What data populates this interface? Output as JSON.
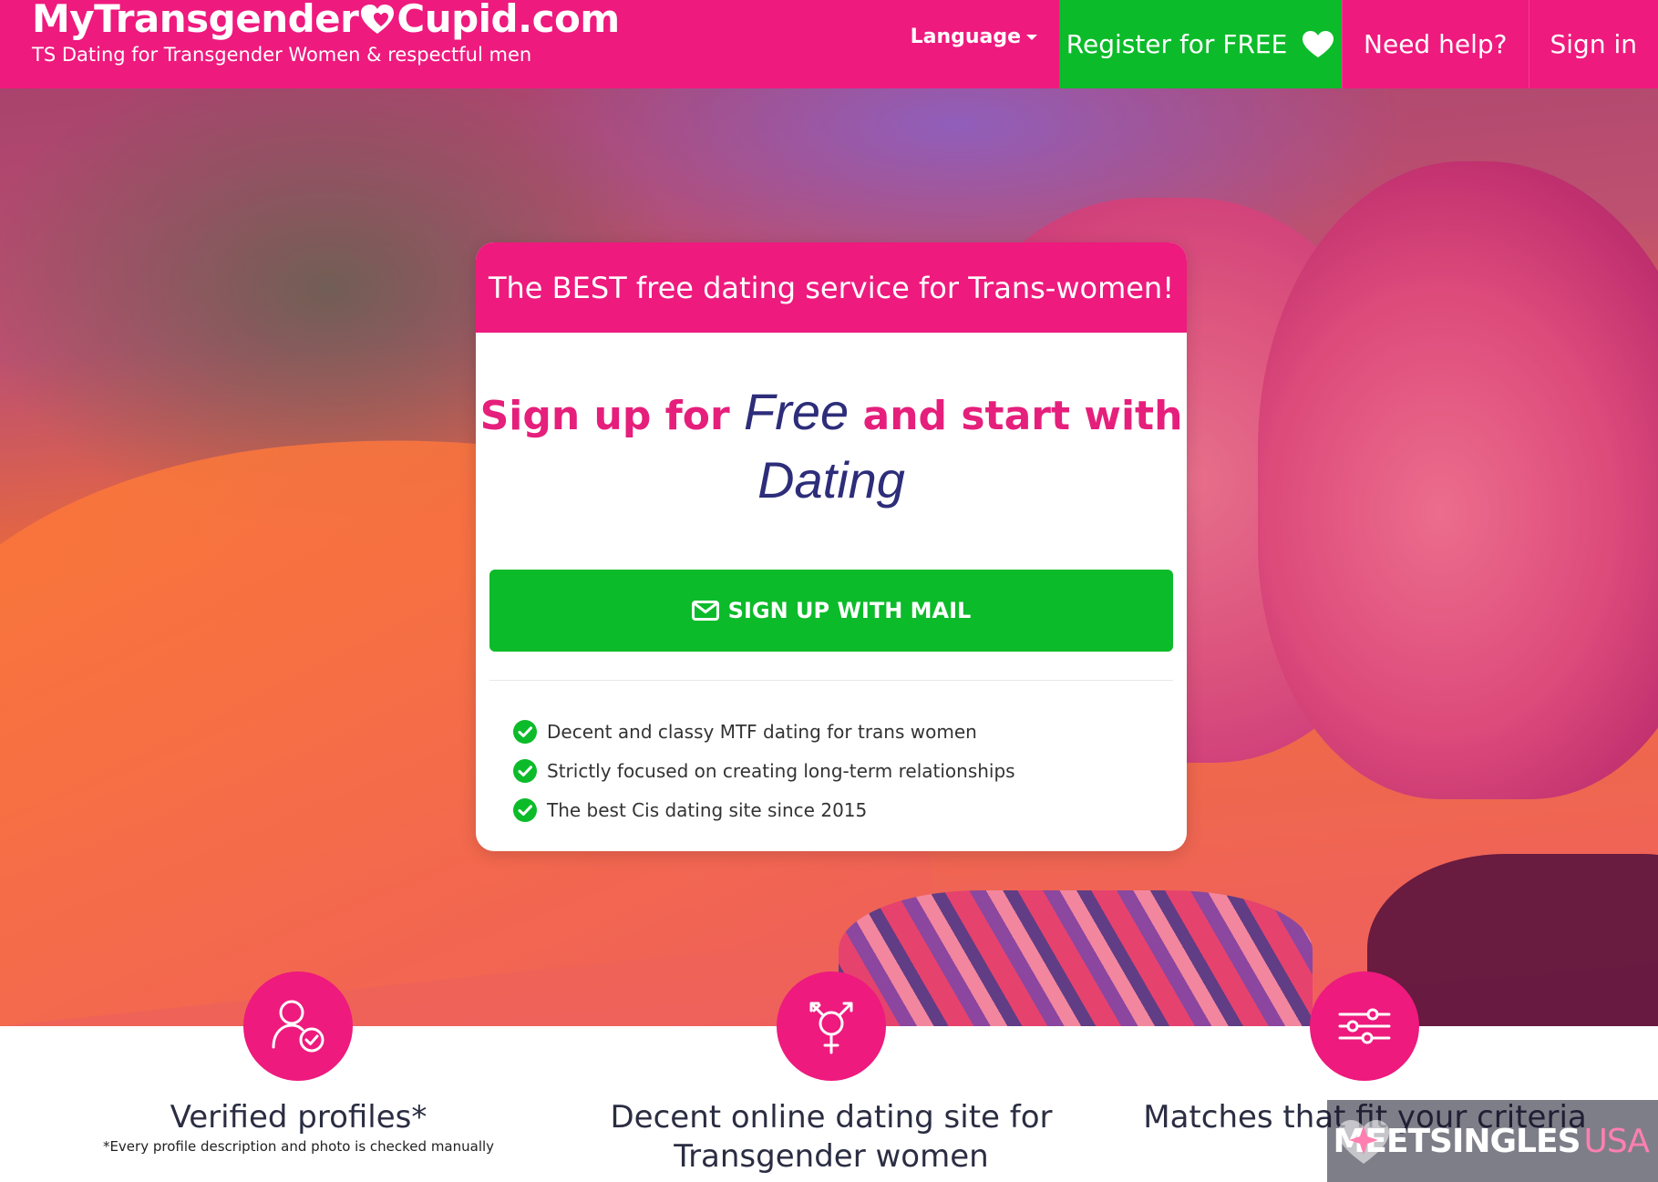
{
  "header": {
    "logo_part1": "MyTransgender",
    "logo_part2": "Cupid.com",
    "tagline": "TS Dating for Transgender Women & respectful men",
    "nav": {
      "language": "Language",
      "register": "Register for FREE",
      "help": "Need help?",
      "signin": "Sign in"
    }
  },
  "card": {
    "header": "The BEST free dating service for Trans-women!",
    "title_part1": "Sign up for",
    "title_accent1": "Free",
    "title_part2": "and start with",
    "title_accent2": "Dating",
    "button": "SIGN UP WITH MAIL",
    "features": [
      "Decent and classy MTF dating for trans women",
      "Strictly focused on creating long-term relationships",
      "The best Cis dating site since 2015"
    ]
  },
  "features": [
    {
      "icon": "verified-user-icon",
      "title": "Verified profiles*",
      "note": "*Every profile description and photo is checked manually"
    },
    {
      "icon": "transgender-symbol-icon",
      "title_line1": "Decent online dating site for",
      "title_line2": "Transgender women"
    },
    {
      "icon": "sliders-icon",
      "title": "Matches that fit your criteria"
    }
  ],
  "watermark": {
    "main": "MEETSINGLES",
    "suffix": "USA"
  },
  "colors": {
    "brand_pink": "#ee1a7e",
    "cta_green": "#0cbb2a",
    "accent_navy": "#2d2d7a",
    "title_text": "#2b2d42"
  }
}
